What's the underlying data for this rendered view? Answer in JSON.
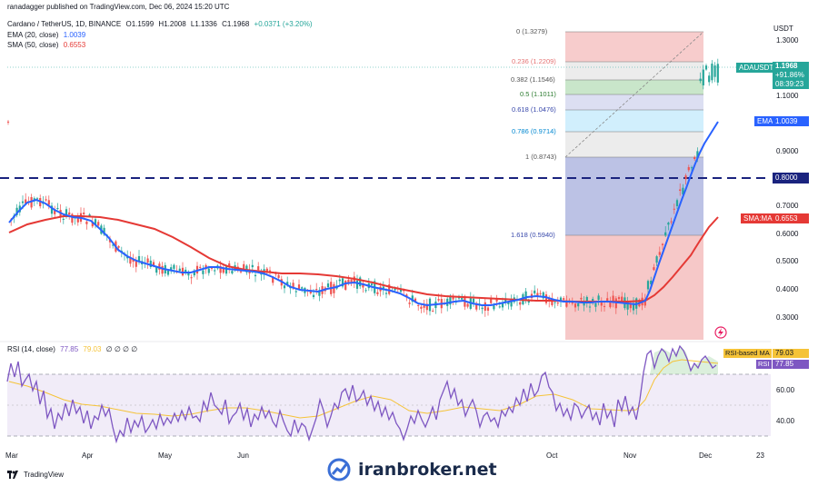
{
  "header": {
    "publisher_line": "ranadagger published on TradingView.com, Dec 06, 2024 15:20 UTC",
    "symbol": "Cardano / TetherUS, 1D, BINANCE",
    "open": "O1.1599",
    "high": "H1.2008",
    "low": "L1.1336",
    "close": "C1.1968",
    "change": "+0.0371 (+3.20%)"
  },
  "indicators": {
    "ema_label": "EMA (20, close)",
    "ema_value": "1.0039",
    "sma_label": "SMA (50, close)",
    "sma_value": "0.6553",
    "rsi_label": "RSI (14, close)",
    "rsi_value": "77.85",
    "rsi_ma_value": "79.03",
    "rsi_extra": "∅ ∅ ∅ ∅"
  },
  "axis": {
    "currency": "USDT",
    "price_ticks": [
      "1.3000",
      "1.1000",
      "0.9000",
      "0.7000",
      "0.6000",
      "0.5000",
      "0.4000",
      "0.3000"
    ],
    "rsi_ticks": [
      "60.00",
      "40.00"
    ],
    "months": [
      "Mar",
      "Apr",
      "May",
      "Jun",
      "Oct",
      "Nov",
      "Dec",
      "23"
    ]
  },
  "tags": {
    "symbol_tag": "ADAUSDT",
    "price": "1.1968",
    "change_pct": "+91.86%",
    "countdown": "08:39:23",
    "ema_tag": "EMA",
    "ema_price": "1.0039",
    "hline_price": "0.8000",
    "sma_tag": "SMA:MA",
    "sma_price": "0.6553",
    "rsi_ma_tag": "RSI-based MA",
    "rsi_ma_val": "79.03",
    "rsi_tag": "RSI",
    "rsi_val": "77.85"
  },
  "fib_levels": [
    {
      "label": "0 (1.3279)"
    },
    {
      "label": "0.236 (1.2209)"
    },
    {
      "label": "0.382 (1.1546)"
    },
    {
      "label": "0.5 (1.1011)"
    },
    {
      "label": "0.618 (1.0476)"
    },
    {
      "label": "0.786 (0.9714)"
    },
    {
      "label": "1 (0.8743)"
    },
    {
      "label": "1.618 (0.5940)"
    }
  ],
  "colors": {
    "up": "#26a69a",
    "down": "#ef5350",
    "ema": "#2962ff",
    "sma": "#e53935",
    "rsi": "#7e57c2",
    "rsi_ma": "#f5c338",
    "hline": "#1a237e"
  },
  "footer": {
    "brand": "TradingView",
    "watermark": "iranbroker.net"
  }
}
